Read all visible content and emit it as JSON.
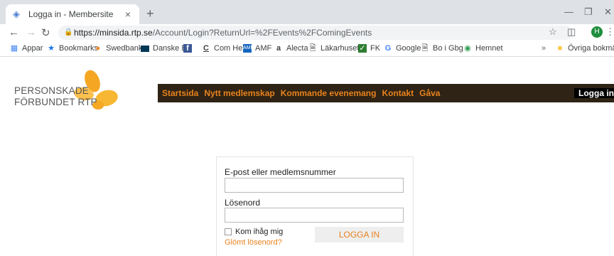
{
  "browser": {
    "tab_title": "Logga in - Membersite",
    "tab_close": "×",
    "new_tab": "+",
    "url_domain": "https://minsida.rtp.se",
    "url_path": "/Account/Login?ReturnUrl=%2FEvents%2FComingEvents",
    "profile_initial": "H"
  },
  "bookmarks": [
    {
      "label": "Appar",
      "icon": "apps-grid-icon"
    },
    {
      "label": "Bookmarks",
      "icon": "star-icon"
    },
    {
      "label": "Swedbank",
      "icon": "swedbank-icon"
    },
    {
      "label": "Danske B",
      "icon": "danske-icon"
    },
    {
      "label": "",
      "icon": "facebook-icon"
    },
    {
      "label": "Com Hem",
      "icon": "comhem-icon"
    },
    {
      "label": "AMF",
      "icon": "amf-icon"
    },
    {
      "label": "Alecta",
      "icon": "alecta-icon"
    },
    {
      "label": "Läkarhuset",
      "icon": "page-icon"
    },
    {
      "label": "FK",
      "icon": "fk-icon"
    },
    {
      "label": "Google",
      "icon": "google-icon"
    },
    {
      "label": "Bo i Gbg",
      "icon": "page-icon"
    },
    {
      "label": "Hemnet",
      "icon": "hemnet-icon"
    }
  ],
  "bookmarks_more": "»",
  "other_bookmarks": "Övriga bokmärken",
  "site": {
    "logo_line1": "PERSONSKADE",
    "logo_line2": "FÖRBUNDET RTP",
    "nav": [
      "Startsida",
      "Nytt medlemskap",
      "Kommande evenemang",
      "Kontakt",
      "Gåva"
    ],
    "nav_login": "Logga in",
    "colors": {
      "accent": "#e8821e",
      "nav_bg": "#2e2314"
    }
  },
  "form": {
    "email_label": "E-post eller medlemsnummer",
    "email_value": "",
    "password_label": "Lösenord",
    "password_value": "",
    "remember_label": "Kom ihåg mig",
    "forgot_label": "Glömt lösenord?",
    "submit_label": "LOGGA IN"
  }
}
